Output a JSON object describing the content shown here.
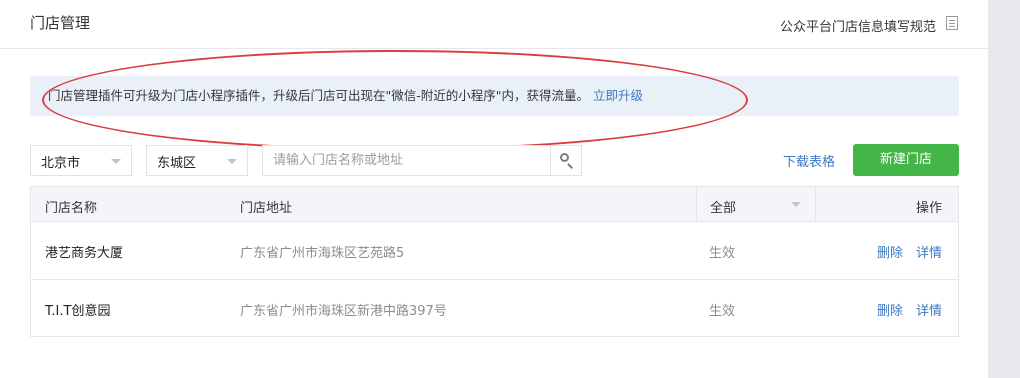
{
  "header": {
    "title": "门店管理",
    "guide_link": "公众平台门店信息填写规范",
    "guide_icon": "document-icon"
  },
  "notice": {
    "text": "门店管理插件可升级为门店小程序插件，升级后门店可出现在\"微信-附近的小程序\"内，获得流量。",
    "upgrade_link": "立即升级"
  },
  "filters": {
    "city": "北京市",
    "district": "东城区",
    "search_placeholder": "请输入门店名称或地址",
    "search_icon": "search-icon"
  },
  "toolbar": {
    "download_label": "下载表格",
    "new_store_label": "新建门店"
  },
  "table": {
    "headers": {
      "name": "门店名称",
      "address": "门店地址",
      "status": "全部",
      "actions": "操作"
    },
    "rows": [
      {
        "name": "港艺商务大厦",
        "address": "广东省广州市海珠区艺苑路5",
        "status": "生效",
        "delete": "删除",
        "detail": "详情"
      },
      {
        "name": "T.I.T创意园",
        "address": "广东省广州市海珠区新港中路397号",
        "status": "生效",
        "delete": "删除",
        "detail": "详情"
      }
    ]
  },
  "colors": {
    "accent_green": "#44b549",
    "link_blue": "#3d78c4",
    "notice_bg": "#e9f0f8",
    "annotation_red": "#d93e3e"
  }
}
